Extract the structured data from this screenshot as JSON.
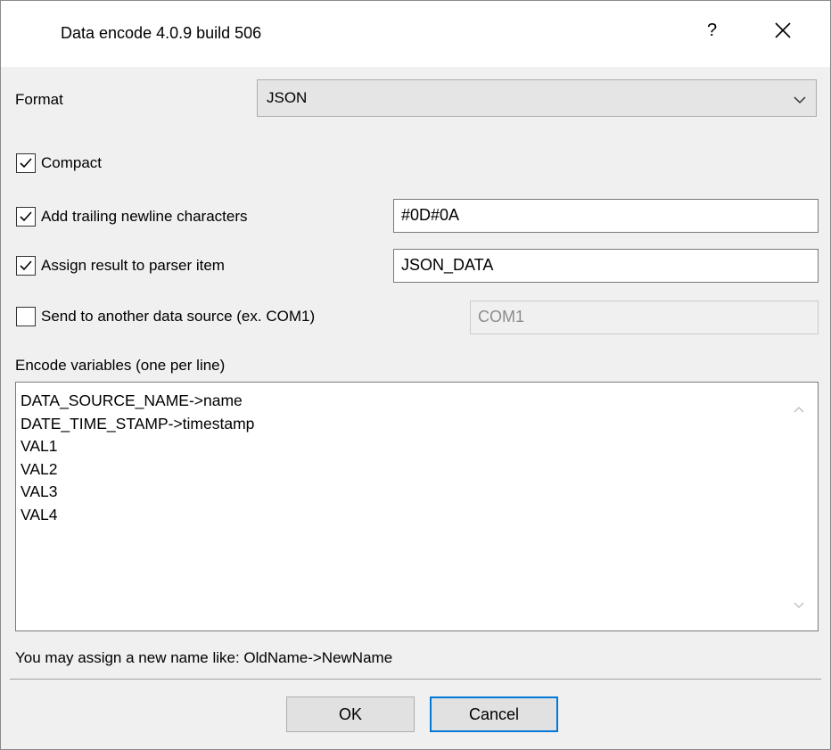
{
  "window": {
    "title": "Data encode 4.0.9 build 506",
    "help_label": "?",
    "close_icon": "close-icon"
  },
  "format": {
    "label": "Format",
    "selected": "JSON"
  },
  "options": {
    "compact": {
      "label": "Compact",
      "checked": true
    },
    "trailing_newline": {
      "label": "Add trailing newline characters",
      "checked": true,
      "value": "#0D#0A"
    },
    "assign_result": {
      "label": "Assign result to parser item",
      "checked": true,
      "value": "JSON_DATA"
    },
    "send_to_source": {
      "label": "Send to another data source (ex. COM1)",
      "checked": false,
      "value": "COM1"
    }
  },
  "variables": {
    "label": "Encode variables (one per line)",
    "lines": [
      "DATA_SOURCE_NAME->name",
      "DATE_TIME_STAMP->timestamp",
      "VAL1",
      "VAL2",
      "VAL3",
      "VAL4"
    ]
  },
  "hint": "You may assign a new name like: OldName->NewName",
  "buttons": {
    "ok": "OK",
    "cancel": "Cancel"
  }
}
